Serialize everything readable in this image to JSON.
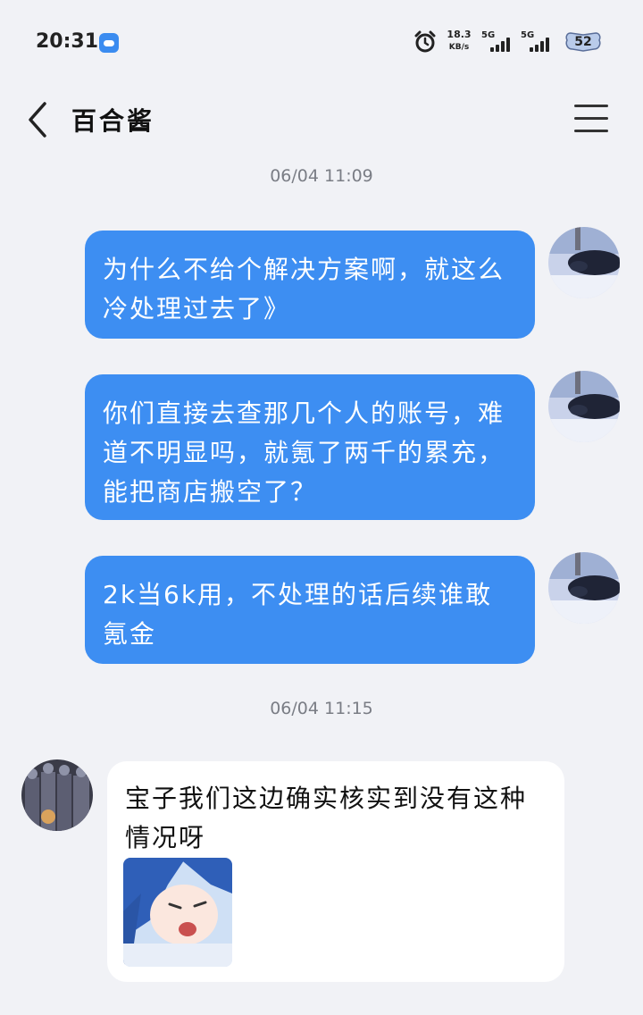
{
  "status_bar": {
    "time": "20:31",
    "speed_value": "18.3",
    "speed_unit": "KB/s",
    "signal1_label": "5G",
    "signal2_label": "5G",
    "battery": "52",
    "icons": [
      "weather-icon",
      "alarm-icon",
      "signal-icon",
      "battery-icon"
    ]
  },
  "header": {
    "title": "百合酱",
    "back_icon": "chevron-left-icon",
    "menu_icon": "hamburger-menu-icon"
  },
  "messages": [
    {
      "type": "timestamp",
      "text": "06/04 11:09"
    },
    {
      "type": "sent",
      "text": "为什么不给个解决方案啊，就这么冷处理过去了》"
    },
    {
      "type": "sent",
      "text": "你们直接去查那几个人的账号，难道不明显吗，就氪了两千的累充，能把商店搬空了？"
    },
    {
      "type": "sent",
      "text": "2k当6k用，不处理的话后续谁敢氪金"
    },
    {
      "type": "timestamp",
      "text": "06/04 11:15"
    },
    {
      "type": "received",
      "text": "宝子我们这边确实核实到没有这种情况呀",
      "has_sticker": true
    }
  ],
  "colors": {
    "background": "#f1f2f6",
    "sent_bubble": "#3d8ef2",
    "received_bubble": "#ffffff",
    "timestamp": "#7a7d85"
  }
}
